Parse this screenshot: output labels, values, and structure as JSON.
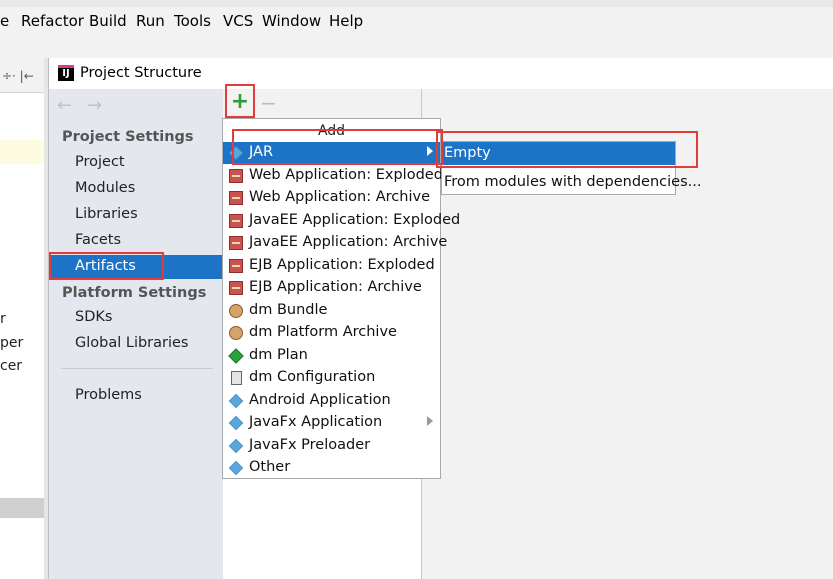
{
  "menubar": {
    "items": [
      {
        "label": "e"
      },
      {
        "label": "Refactor"
      },
      {
        "label": "Build"
      },
      {
        "label": "Run"
      },
      {
        "label": "Tools"
      },
      {
        "label": "VCS"
      },
      {
        "label": "Window"
      },
      {
        "label": "Help"
      }
    ]
  },
  "background_panel": {
    "toolbar_text": "÷· |←",
    "fragments": [
      "r",
      "per",
      "cer"
    ]
  },
  "dialog": {
    "title": "Project Structure",
    "app_icon_text": "IJ"
  },
  "nav": {
    "back_icon": "←",
    "forward_icon": "→",
    "project_settings_header": "Project Settings",
    "project_settings_items": [
      "Project",
      "Modules",
      "Libraries",
      "Facets",
      "Artifacts"
    ],
    "platform_settings_header": "Platform Settings",
    "platform_settings_items": [
      "SDKs",
      "Global Libraries"
    ],
    "problems": "Problems",
    "selected": "Artifacts"
  },
  "artifacts_toolbar": {
    "add_icon": "+",
    "remove_icon": "−"
  },
  "add_menu": {
    "header": "Add",
    "items": [
      {
        "label": "JAR",
        "icon": "diamond-icon",
        "submenu": true,
        "selected": true
      },
      {
        "label": "Web Application: Exploded",
        "icon": "box-icon"
      },
      {
        "label": "Web Application: Archive",
        "icon": "box-icon"
      },
      {
        "label": "JavaEE Application: Exploded",
        "icon": "box-icon"
      },
      {
        "label": "JavaEE Application: Archive",
        "icon": "box-icon"
      },
      {
        "label": "EJB Application: Exploded",
        "icon": "box-icon"
      },
      {
        "label": "EJB Application: Archive",
        "icon": "box-icon"
      },
      {
        "label": "dm Bundle",
        "icon": "ore-icon"
      },
      {
        "label": "dm Platform Archive",
        "icon": "ore-icon"
      },
      {
        "label": "dm Plan",
        "icon": "plan-icon"
      },
      {
        "label": "dm Configuration",
        "icon": "document-icon"
      },
      {
        "label": "Android Application",
        "icon": "diamond-icon"
      },
      {
        "label": "JavaFx Application",
        "icon": "diamond-icon",
        "submenu": true
      },
      {
        "label": "JavaFx Preloader",
        "icon": "diamond-icon"
      },
      {
        "label": "Other",
        "icon": "diamond-icon"
      }
    ]
  },
  "jar_submenu": {
    "items": [
      {
        "label": "Empty",
        "selected": true
      },
      {
        "label": "From modules with dependencies..."
      }
    ]
  },
  "colors": {
    "selection": "#1d74c7",
    "highlight_border": "#e23b3b",
    "nav_background": "#e4e8ee"
  }
}
